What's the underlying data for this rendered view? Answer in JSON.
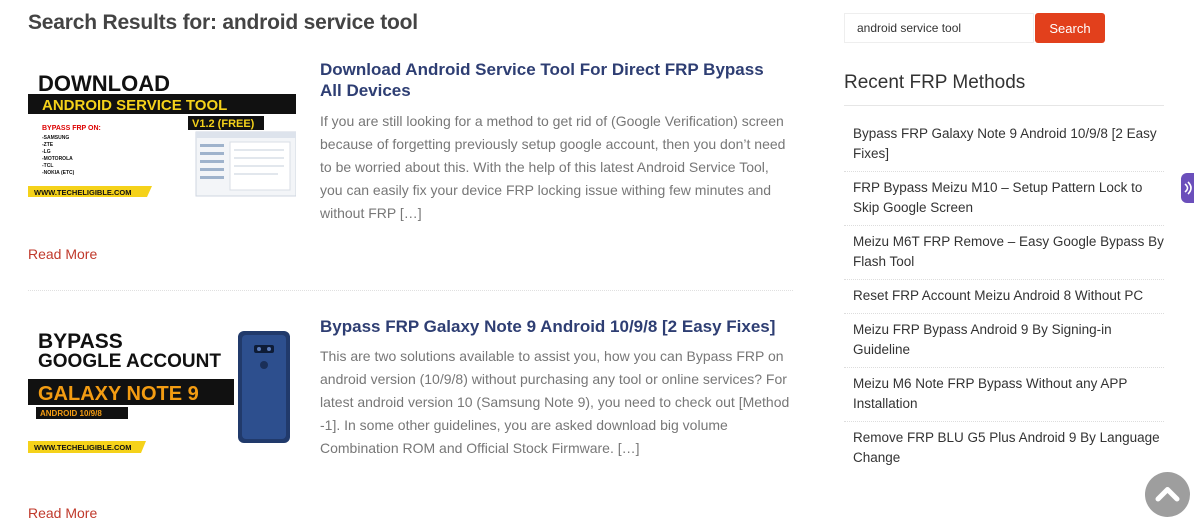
{
  "page": {
    "heading": "Search Results for: android service tool"
  },
  "posts": [
    {
      "title": "Download Android Service Tool For Direct FRP Bypass All Devices",
      "excerpt": "If you are still looking for a method to get rid of (Google Verification) screen because of forgetting previously setup google account, then you don’t need to be worried about this. With the help of this latest Android Service Tool, you can easily fix your device FRP locking issue withing few minutes and without FRP […]",
      "read_more": "Read More",
      "thumb": {
        "line1": "DOWNLOAD",
        "line2": "ANDROID SERVICE TOOL",
        "version": "V1.2 (FREE)",
        "bypass_label": "BYPASS FRP ON:",
        "brands": [
          "-SAMSUNG",
          "-ZTE",
          "-LG",
          "-MOTOROLA",
          "-TCL",
          "-NOKIA (ETC)"
        ],
        "site": "WWW.TECHELIGIBLE.COM"
      }
    },
    {
      "title": "Bypass FRP Galaxy Note 9 Android 10/9/8 [2 Easy Fixes]",
      "excerpt": "This are two solutions available to assist you, how you can Bypass FRP on android version (10/9/8) without purchasing any tool or online services? For latest android version 10 (Samsung Note 9), you need to check out [Method -1]. In some other guidelines, you are asked download big volume Combination ROM and Official Stock Firmware. […]",
      "read_more": "Read More",
      "thumb": {
        "line1": "BYPASS",
        "line2": "GOOGLE ACCOUNT",
        "line3": "GALAXY NOTE 9",
        "line4": "ANDROID 10/9/8",
        "site": "WWW.TECHELIGIBLE.COM"
      }
    }
  ],
  "sidebar": {
    "search_value": "android service tool",
    "search_button": "Search",
    "widget_title": "Recent FRP Methods",
    "recent": [
      "Bypass FRP Galaxy Note 9 Android 10/9/8 [2 Easy Fixes]",
      "FRP Bypass Meizu M10 – Setup Pattern Lock to Skip Google Screen",
      "Meizu M6T FRP Remove – Easy Google Bypass By Flash Tool",
      "Reset FRP Account Meizu Android 8 Without PC",
      "Meizu FRP Bypass Android 9 By Signing-in Guideline",
      "Meizu M6 Note FRP Bypass Without any APP Installation",
      "Remove FRP BLU G5 Plus Android 9 By Language Change"
    ]
  },
  "icons": {
    "back_to_top": "chevron-up-icon",
    "side_tab": "feedback-icon"
  },
  "colors": {
    "accent": "#e2401c",
    "title": "#2e3e73",
    "read_more": "#c0392b"
  }
}
